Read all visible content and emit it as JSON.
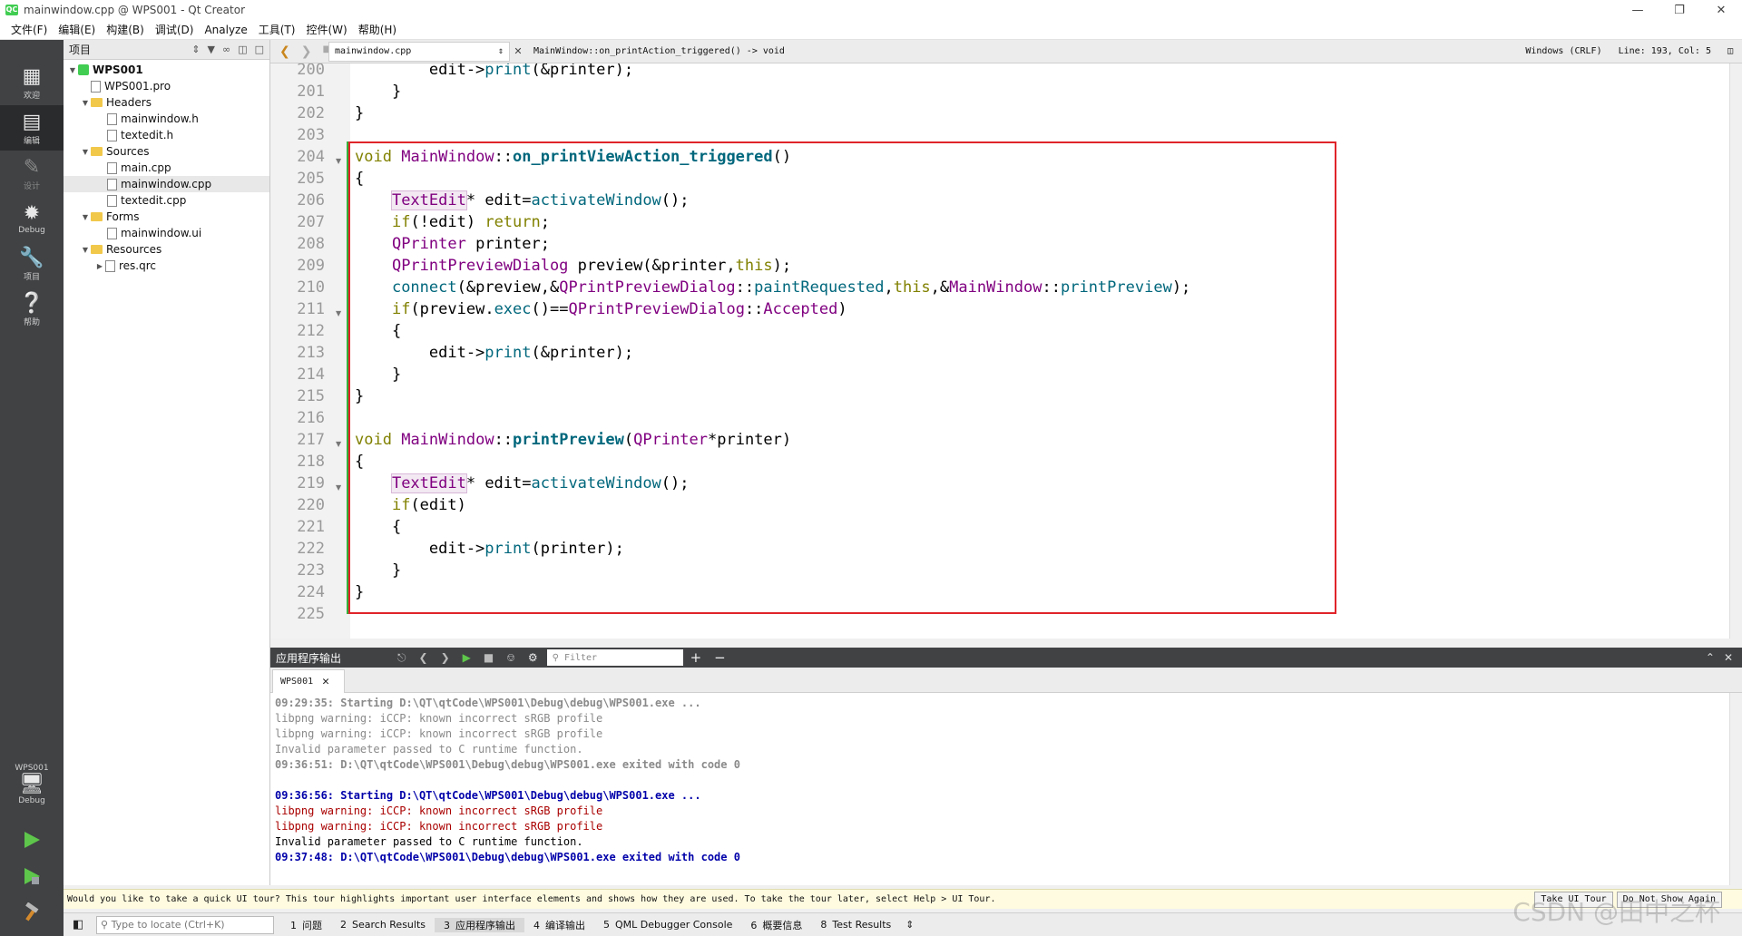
{
  "window": {
    "title": "mainwindow.cpp @ WPS001 - Qt Creator",
    "app_icon": "QC"
  },
  "menu": [
    "文件(F)",
    "编辑(E)",
    "构建(B)",
    "调试(D)",
    "Analyze",
    "工具(T)",
    "控件(W)",
    "帮助(H)"
  ],
  "modes": [
    {
      "label": "欢迎",
      "icon": "grid-icon"
    },
    {
      "label": "编辑",
      "icon": "edit-icon"
    },
    {
      "label": "设计",
      "icon": "pencil-icon"
    },
    {
      "label": "Debug",
      "icon": "bug-icon"
    },
    {
      "label": "项目",
      "icon": "wrench-icon"
    },
    {
      "label": "帮助",
      "icon": "help-icon"
    }
  ],
  "kit": {
    "project": "WPS001",
    "config": "Debug"
  },
  "project_pane": {
    "title": "项目",
    "tree": {
      "root": "WPS001",
      "pro": "WPS001.pro",
      "headers": "Headers",
      "header_files": [
        "mainwindow.h",
        "textedit.h"
      ],
      "sources": "Sources",
      "source_files": [
        "main.cpp",
        "mainwindow.cpp",
        "textedit.cpp"
      ],
      "forms": "Forms",
      "form_files": [
        "mainwindow.ui"
      ],
      "resources": "Resources",
      "resource_files": [
        "res.qrc"
      ]
    }
  },
  "editor_toolbar": {
    "file": "mainwindow.cpp",
    "symbol": "MainWindow::on_printAction_triggered() -> void",
    "line_ending": "Windows (CRLF)",
    "position": "Line: 193, Col: 5"
  },
  "code": {
    "line_numbers": [
      "200",
      "201",
      "202",
      "203",
      "204",
      "205",
      "206",
      "207",
      "208",
      "209",
      "210",
      "211",
      "212",
      "213",
      "214",
      "215",
      "216",
      "217",
      "218",
      "219",
      "220",
      "221",
      "222",
      "223",
      "224",
      "225"
    ]
  },
  "output": {
    "title": "应用程序输出",
    "filter_placeholder": "Filter",
    "tab": "WPS001",
    "lines": [
      "09:29:35: Starting D:\\QT\\qtCode\\WPS001\\Debug\\debug\\WPS001.exe ...",
      "libpng warning: iCCP: known incorrect sRGB profile",
      "libpng warning: iCCP: known incorrect sRGB profile",
      "Invalid parameter passed to C runtime function.",
      "09:36:51: D:\\QT\\qtCode\\WPS001\\Debug\\debug\\WPS001.exe exited with code 0",
      "",
      "09:36:56: Starting D:\\QT\\qtCode\\WPS001\\Debug\\debug\\WPS001.exe ...",
      "libpng warning: iCCP: known incorrect sRGB profile",
      "libpng warning: iCCP: known incorrect sRGB profile",
      "Invalid parameter passed to C runtime function.",
      "09:37:48: D:\\QT\\qtCode\\WPS001\\Debug\\debug\\WPS001.exe exited with code 0"
    ]
  },
  "infobar": {
    "text": "Would you like to take a quick UI tour? This tour highlights important user interface elements and shows how they are used. To take the tour later, select Help > UI Tour.",
    "take_tour": "Take UI Tour",
    "dont_show": "Do Not Show Again"
  },
  "statusbar": {
    "locate_placeholder": "Type to locate (Ctrl+K)",
    "tabs": [
      {
        "n": "1",
        "label": "问题"
      },
      {
        "n": "2",
        "label": "Search Results"
      },
      {
        "n": "3",
        "label": "应用程序输出"
      },
      {
        "n": "4",
        "label": "编译输出"
      },
      {
        "n": "5",
        "label": "QML Debugger Console"
      },
      {
        "n": "6",
        "label": "概要信息"
      },
      {
        "n": "8",
        "label": "Test Results"
      }
    ]
  },
  "watermark": "CSDN @田中之杯",
  "colors": {
    "highlight_box": "#e0242a",
    "modebar": "#404244",
    "keyword": "#808000",
    "type": "#800080",
    "function": "#00677c"
  }
}
